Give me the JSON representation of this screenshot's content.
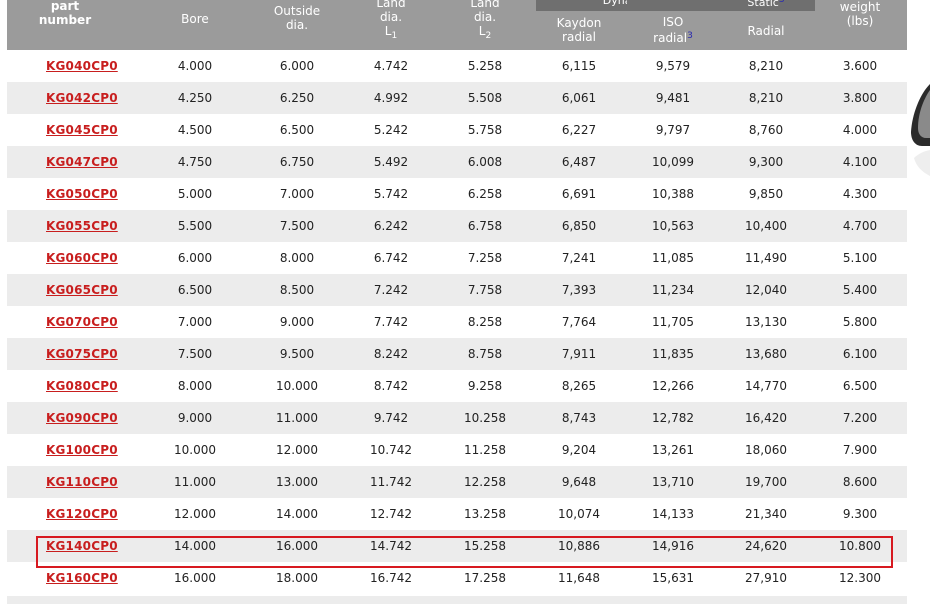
{
  "header": {
    "part_number": [
      "part",
      "number"
    ],
    "bore": "Bore",
    "outside_dia": [
      "Outside",
      "dia."
    ],
    "land_dia_l1": [
      "Land",
      "dia.",
      "L",
      "1"
    ],
    "land_dia_l2": [
      "Land",
      "dia.",
      "L",
      "2"
    ],
    "dynamic_group": "Dynamic",
    "static_group": "Static",
    "static_group_sup": "3",
    "kaydon_radial": [
      "Kaydon",
      "radial"
    ],
    "iso_radial": [
      "ISO",
      "radial"
    ],
    "iso_radial_sup": "3",
    "static_radial": "Radial",
    "weight": [
      "weight",
      "(lbs)"
    ]
  },
  "rows": [
    [
      "KG040CP0",
      "4.000",
      "6.000",
      "4.742",
      "5.258",
      "6,115",
      "9,579",
      "8,210",
      "3.600"
    ],
    [
      "KG042CP0",
      "4.250",
      "6.250",
      "4.992",
      "5.508",
      "6,061",
      "9,481",
      "8,210",
      "3.800"
    ],
    [
      "KG045CP0",
      "4.500",
      "6.500",
      "5.242",
      "5.758",
      "6,227",
      "9,797",
      "8,760",
      "4.000"
    ],
    [
      "KG047CP0",
      "4.750",
      "6.750",
      "5.492",
      "6.008",
      "6,487",
      "10,099",
      "9,300",
      "4.100"
    ],
    [
      "KG050CP0",
      "5.000",
      "7.000",
      "5.742",
      "6.258",
      "6,691",
      "10,388",
      "9,850",
      "4.300"
    ],
    [
      "KG055CP0",
      "5.500",
      "7.500",
      "6.242",
      "6.758",
      "6,850",
      "10,563",
      "10,400",
      "4.700"
    ],
    [
      "KG060CP0",
      "6.000",
      "8.000",
      "6.742",
      "7.258",
      "7,241",
      "11,085",
      "11,490",
      "5.100"
    ],
    [
      "KG065CP0",
      "6.500",
      "8.500",
      "7.242",
      "7.758",
      "7,393",
      "11,234",
      "12,040",
      "5.400"
    ],
    [
      "KG070CP0",
      "7.000",
      "9.000",
      "7.742",
      "8.258",
      "7,764",
      "11,705",
      "13,130",
      "5.800"
    ],
    [
      "KG075CP0",
      "7.500",
      "9.500",
      "8.242",
      "8.758",
      "7,911",
      "11,835",
      "13,680",
      "6.100"
    ],
    [
      "KG080CP0",
      "8.000",
      "10.000",
      "8.742",
      "9.258",
      "8,265",
      "12,266",
      "14,770",
      "6.500"
    ],
    [
      "KG090CP0",
      "9.000",
      "11.000",
      "9.742",
      "10.258",
      "8,743",
      "12,782",
      "16,420",
      "7.200"
    ],
    [
      "KG100CP0",
      "10.000",
      "12.000",
      "10.742",
      "11.258",
      "9,204",
      "13,261",
      "18,060",
      "7.900"
    ],
    [
      "KG110CP0",
      "11.000",
      "13.000",
      "11.742",
      "12.258",
      "9,648",
      "13,710",
      "19,700",
      "8.600"
    ],
    [
      "KG120CP0",
      "12.000",
      "14.000",
      "12.742",
      "13.258",
      "10,074",
      "14,133",
      "21,340",
      "9.300"
    ],
    [
      "KG140CP0",
      "14.000",
      "16.000",
      "14.742",
      "15.258",
      "10,886",
      "14,916",
      "24,620",
      "10.800"
    ],
    [
      "KG160CP0",
      "16.000",
      "18.000",
      "16.742",
      "17.258",
      "11,648",
      "15,631",
      "27,910",
      "12.300"
    ]
  ],
  "highlighted_part": "KG140CP0",
  "colors": {
    "header_bg": "#9b9b9b",
    "group_band": "#6f6f6f",
    "link_red": "#c81e1e",
    "highlight_border": "#d71920",
    "stripe": "#ececec"
  }
}
